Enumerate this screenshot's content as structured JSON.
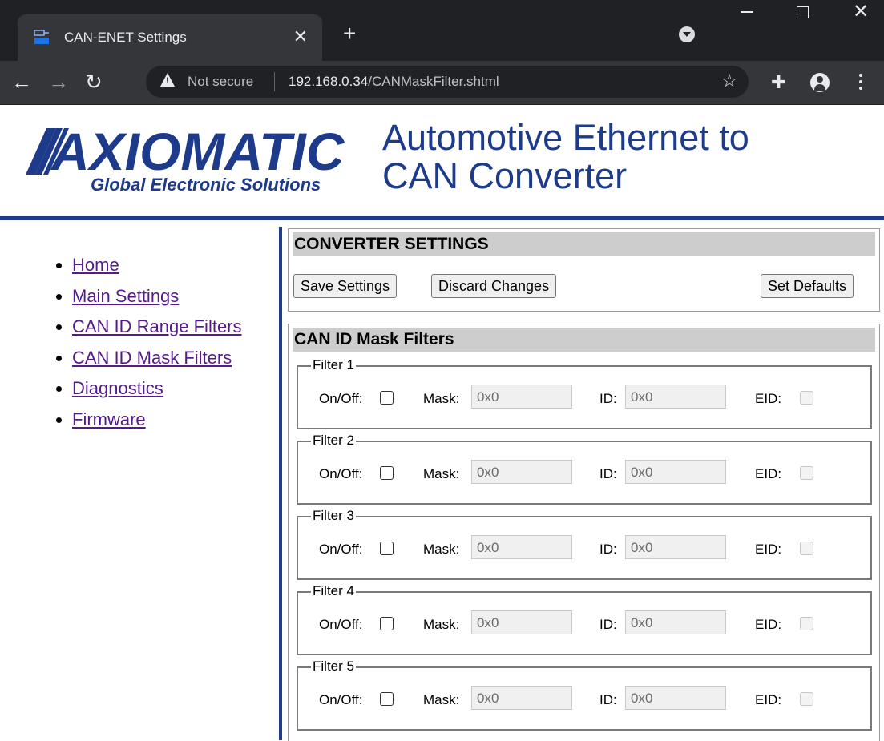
{
  "browser": {
    "tab_title": "CAN-ENET Settings",
    "favicon": "can-ip-icon",
    "security_label": "Not secure",
    "url_host": "192.168.0.34",
    "url_path": "/CANMaskFilter.shtml",
    "icons": [
      "close-icon",
      "plus-icon",
      "chevron-down-icon",
      "minimize-icon",
      "maximize-icon",
      "window-close-icon",
      "back-arrow-icon",
      "forward-arrow-icon",
      "reload-icon",
      "warning-icon",
      "star-icon",
      "puzzle-icon",
      "profile-icon",
      "more-vert-icon"
    ]
  },
  "logo": {
    "brand": "AXIOMATIC",
    "tagline": "Global Electronic Solutions",
    "color": "#1e3a8a"
  },
  "page_title_line1": "Automotive Ethernet to",
  "page_title_line2": "CAN Converter",
  "nav": [
    {
      "label": "Home"
    },
    {
      "label": "Main Settings"
    },
    {
      "label": "CAN ID Range Filters"
    },
    {
      "label": "CAN ID Mask Filters"
    },
    {
      "label": "Diagnostics"
    },
    {
      "label": "Firmware"
    }
  ],
  "settings": {
    "header": "CONVERTER SETTINGS",
    "save_label": "Save Settings",
    "discard_label": "Discard Changes",
    "defaults_label": "Set Defaults"
  },
  "filters": {
    "header": "CAN ID Mask Filters",
    "onoff_label": "On/Off:",
    "mask_label": "Mask:",
    "id_label": "ID:",
    "eid_label": "EID:",
    "items": [
      {
        "legend": "Filter 1",
        "on": false,
        "mask": "0x0",
        "id": "0x0",
        "eid": false,
        "eid_enabled": false
      },
      {
        "legend": "Filter 2",
        "on": false,
        "mask": "0x0",
        "id": "0x0",
        "eid": false,
        "eid_enabled": false
      },
      {
        "legend": "Filter 3",
        "on": false,
        "mask": "0x0",
        "id": "0x0",
        "eid": false,
        "eid_enabled": false
      },
      {
        "legend": "Filter 4",
        "on": false,
        "mask": "0x0",
        "id": "0x0",
        "eid": false,
        "eid_enabled": false
      },
      {
        "legend": "Filter 5",
        "on": false,
        "mask": "0x0",
        "id": "0x0",
        "eid": false,
        "eid_enabled": false
      }
    ]
  }
}
